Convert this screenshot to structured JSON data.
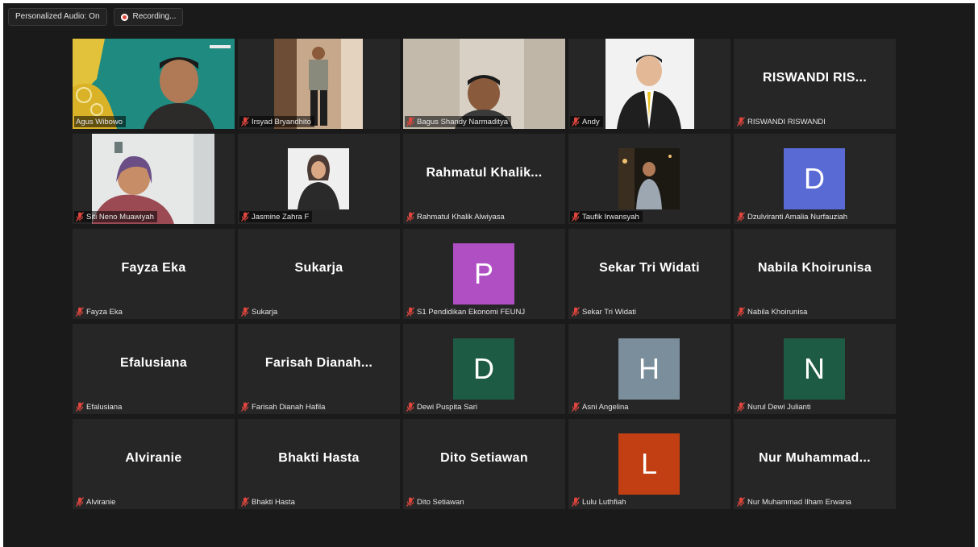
{
  "topbar": {
    "audio_label": "Personalized Audio: On",
    "recording_label": "Recording..."
  },
  "colors": {
    "muted_mic": "#e0463e",
    "active_speaker_border": "#e8e63a",
    "tile_bg": "#262626"
  },
  "participants": [
    {
      "name": "Agus Wibowo",
      "type": "video",
      "muted": false
    },
    {
      "name": "Irsyad Bryandhito",
      "type": "video",
      "muted": true
    },
    {
      "name": "Bagus Shandy Narmaditya",
      "type": "video",
      "muted": true
    },
    {
      "name": "Andy",
      "type": "video",
      "muted": true
    },
    {
      "name": "RISWANDI RISWANDI",
      "type": "name",
      "display": "RISWANDI RIS...",
      "muted": true
    },
    {
      "name": "Siti Neno Muawiyah",
      "type": "video",
      "muted": true
    },
    {
      "name": "Jasmine Zahra F",
      "type": "video",
      "muted": true
    },
    {
      "name": "Rahmatul Khalik Alwiyasa",
      "type": "name",
      "display": "Rahmatul Khalik...",
      "muted": true
    },
    {
      "name": "Taufik Irwansyah",
      "type": "video",
      "muted": true
    },
    {
      "name": "Dzulviranti Amalia Nurfauziah",
      "type": "avatar",
      "initial": "D",
      "color": "#5a6ad4",
      "muted": true
    },
    {
      "name": "Fayza Eka",
      "type": "name",
      "display": "Fayza Eka",
      "muted": true
    },
    {
      "name": "Sukarja",
      "type": "name",
      "display": "Sukarja",
      "muted": true
    },
    {
      "name": "S1 Pendidikan Ekonomi FEUNJ",
      "type": "avatar",
      "initial": "P",
      "color": "#b04fc4",
      "muted": true
    },
    {
      "name": "Sekar Tri Widati",
      "type": "name",
      "display": "Sekar Tri Widati",
      "muted": true
    },
    {
      "name": "Nabila Khoirunisa",
      "type": "name",
      "display": "Nabila Khoirunisa",
      "muted": true
    },
    {
      "name": "Efalusiana",
      "type": "name",
      "display": "Efalusiana",
      "muted": true
    },
    {
      "name": "Farisah Dianah Hafila",
      "type": "name",
      "display": "Farisah Dianah...",
      "muted": true
    },
    {
      "name": "Dewi Puspita Sari",
      "type": "avatar",
      "initial": "D",
      "color": "#1e5b45",
      "muted": true
    },
    {
      "name": "Asni Angelina",
      "type": "avatar",
      "initial": "H",
      "color": "#7a8e9c",
      "muted": true
    },
    {
      "name": "Nurul Dewi Julianti",
      "type": "avatar",
      "initial": "N",
      "color": "#1e5b45",
      "muted": true
    },
    {
      "name": "Alviranie",
      "type": "name",
      "display": "Alviranie",
      "muted": true
    },
    {
      "name": "Bhakti Hasta",
      "type": "name",
      "display": "Bhakti Hasta",
      "muted": true
    },
    {
      "name": "Dito Setiawan",
      "type": "name",
      "display": "Dito Setiawan",
      "muted": true
    },
    {
      "name": "Lulu Luthfiah",
      "type": "avatar",
      "initial": "L",
      "color": "#c23f14",
      "muted": true
    },
    {
      "name": "Nur Muhammad Ilham Erwana",
      "type": "name",
      "display": "Nur Muhammad...",
      "muted": true
    }
  ]
}
